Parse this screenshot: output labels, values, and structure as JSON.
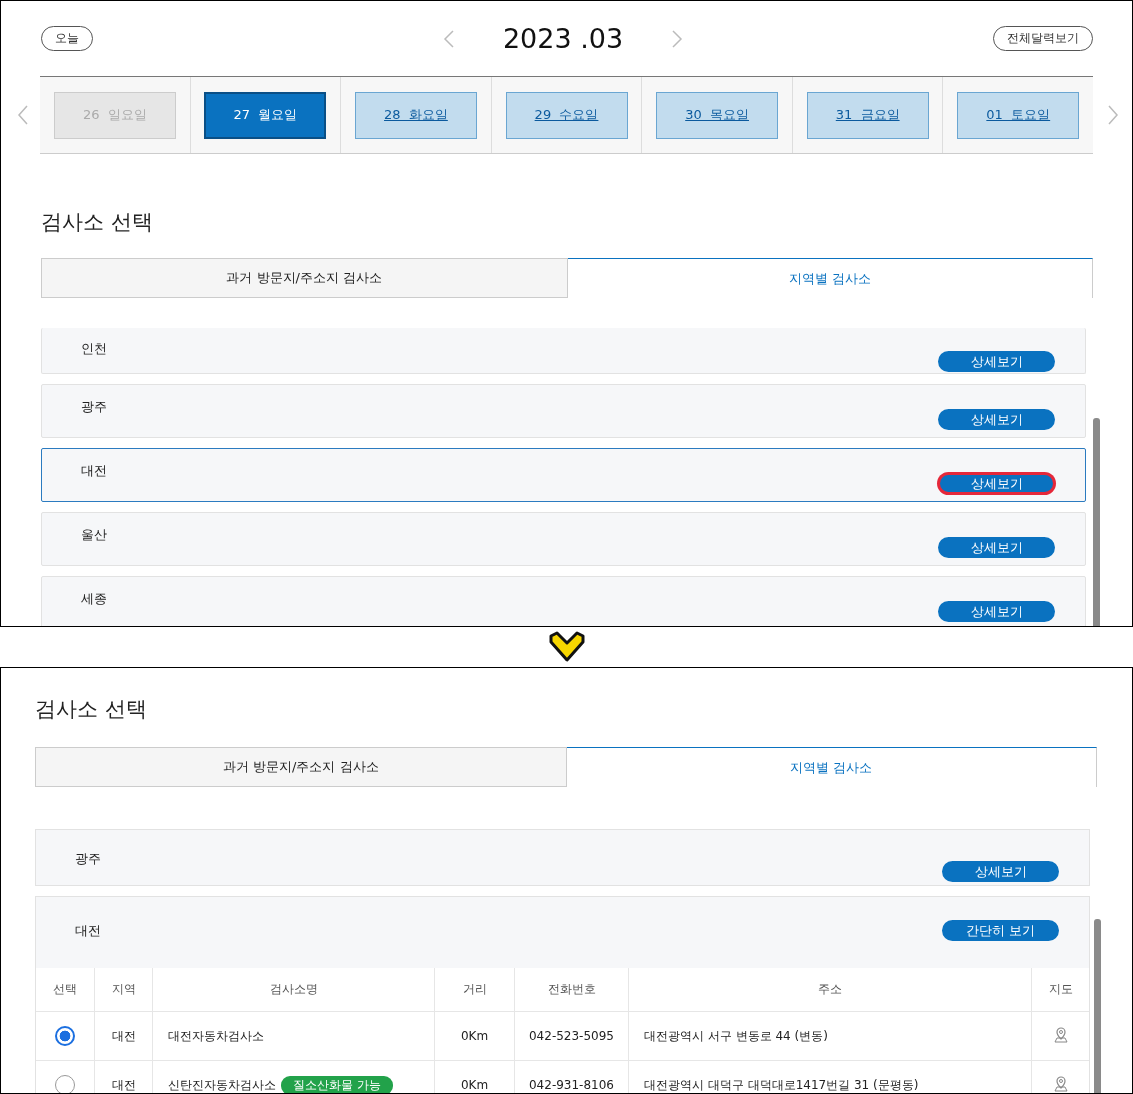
{
  "top_panel": {
    "today_button": "오늘",
    "month": "2023 .03",
    "full_calendar_button": "전체달력보기",
    "days": [
      {
        "day": "26",
        "weekday": "일요일",
        "disabled": true,
        "selected": false
      },
      {
        "day": "27",
        "weekday": "월요일",
        "disabled": false,
        "selected": true
      },
      {
        "day": "28",
        "weekday": "화요일",
        "disabled": false,
        "selected": false
      },
      {
        "day": "29",
        "weekday": "수요일",
        "disabled": false,
        "selected": false
      },
      {
        "day": "30",
        "weekday": "목요일",
        "disabled": false,
        "selected": false
      },
      {
        "day": "31",
        "weekday": "금요일",
        "disabled": false,
        "selected": false
      },
      {
        "day": "01",
        "weekday": "토요일",
        "disabled": false,
        "selected": false
      }
    ],
    "section_title": "검사소 선택",
    "tabs": [
      {
        "label": "과거 방문지/주소지 검사소",
        "selected": false
      },
      {
        "label": "지역별 검사소",
        "selected": true
      }
    ],
    "regions": [
      {
        "name": "인천",
        "button": "상세보기",
        "selected": false,
        "focused": false
      },
      {
        "name": "광주",
        "button": "상세보기",
        "selected": false,
        "focused": false
      },
      {
        "name": "대전",
        "button": "상세보기",
        "selected": true,
        "focused": true
      },
      {
        "name": "울산",
        "button": "상세보기",
        "selected": false,
        "focused": false
      },
      {
        "name": "세종",
        "button": "상세보기",
        "selected": false,
        "focused": false
      }
    ]
  },
  "bottom_panel": {
    "section_title": "검사소 선택",
    "tabs": [
      {
        "label": "과거 방문지/주소지 검사소",
        "selected": false
      },
      {
        "label": "지역별 검사소",
        "selected": true
      }
    ],
    "regions": [
      {
        "name": "광주",
        "button": "상세보기",
        "expanded": false
      },
      {
        "name": "대전",
        "button": "간단히 보기",
        "expanded": true,
        "table": {
          "columns": [
            "선택",
            "지역",
            "검사소명",
            "거리",
            "전화번호",
            "주소",
            "지도"
          ],
          "rows": [
            {
              "selected": true,
              "region": "대전",
              "name": "대전자동차검사소",
              "distance": "0Km",
              "phone": "042-523-5095",
              "address": "대전광역시 서구 변동로 44 (변동)"
            },
            {
              "selected": false,
              "region": "대전",
              "name": "신탄진자동차검사소",
              "badge": "질소산화물 가능",
              "distance": "0Km",
              "phone": "042-931-8106",
              "address": "대전광역시 대덕구 대덕대로1417번길 31 (문평동)"
            }
          ]
        }
      }
    ]
  }
}
